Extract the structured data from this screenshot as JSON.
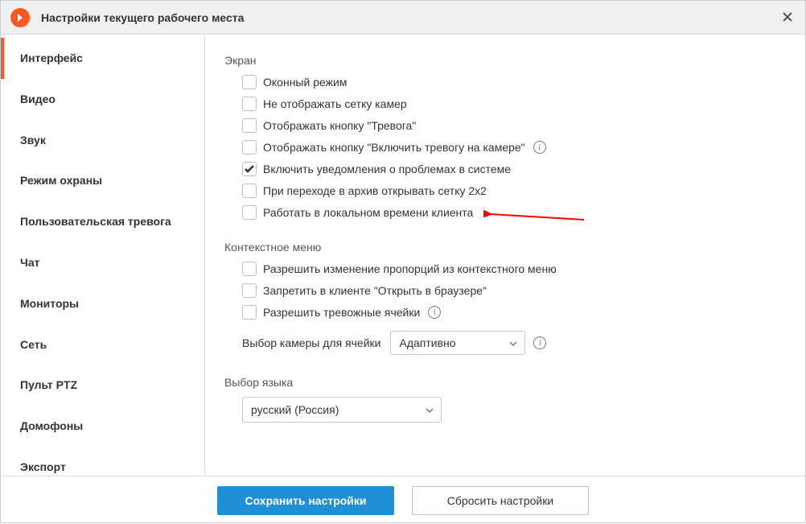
{
  "header": {
    "title": "Настройки текущего рабочего места"
  },
  "sidebar": {
    "items": [
      {
        "label": "Интерфейс",
        "active": true
      },
      {
        "label": "Видео",
        "active": false
      },
      {
        "label": "Звук",
        "active": false
      },
      {
        "label": "Режим охраны",
        "active": false
      },
      {
        "label": "Пользовательская тревога",
        "active": false
      },
      {
        "label": "Чат",
        "active": false
      },
      {
        "label": "Мониторы",
        "active": false
      },
      {
        "label": "Сеть",
        "active": false
      },
      {
        "label": "Пульт PTZ",
        "active": false
      },
      {
        "label": "Домофоны",
        "active": false
      },
      {
        "label": "Экспорт",
        "active": false
      }
    ]
  },
  "sections": {
    "screen": {
      "title": "Экран",
      "checks": [
        {
          "label": "Оконный режим",
          "checked": false,
          "info": false
        },
        {
          "label": "Не отображать сетку камер",
          "checked": false,
          "info": false
        },
        {
          "label": "Отображать кнопку \"Тревога\"",
          "checked": false,
          "info": false
        },
        {
          "label": "Отображать кнопку \"Включить тревогу на камере\"",
          "checked": false,
          "info": true
        },
        {
          "label": "Включить уведомления о проблемах в системе",
          "checked": true,
          "info": false
        },
        {
          "label": "При переходе в архив открывать сетку 2x2",
          "checked": false,
          "info": false
        },
        {
          "label": "Работать в локальном времени клиента",
          "checked": false,
          "info": false
        }
      ]
    },
    "context": {
      "title": "Контекстное меню",
      "checks": [
        {
          "label": "Разрешить изменение пропорций из контекстного меню",
          "checked": false,
          "info": false
        },
        {
          "label": "Запретить в клиенте \"Открыть в браузере\"",
          "checked": false,
          "info": false
        },
        {
          "label": "Разрешить тревожные ячейки",
          "checked": false,
          "info": true
        }
      ],
      "camera_select_label": "Выбор камеры для ячейки",
      "camera_select_value": "Адаптивно"
    },
    "language": {
      "title": "Выбор языка",
      "value": "русский (Россия)"
    }
  },
  "footer": {
    "save": "Сохранить настройки",
    "reset": "Сбросить настройки"
  },
  "icons": {
    "info_glyph": "i"
  }
}
